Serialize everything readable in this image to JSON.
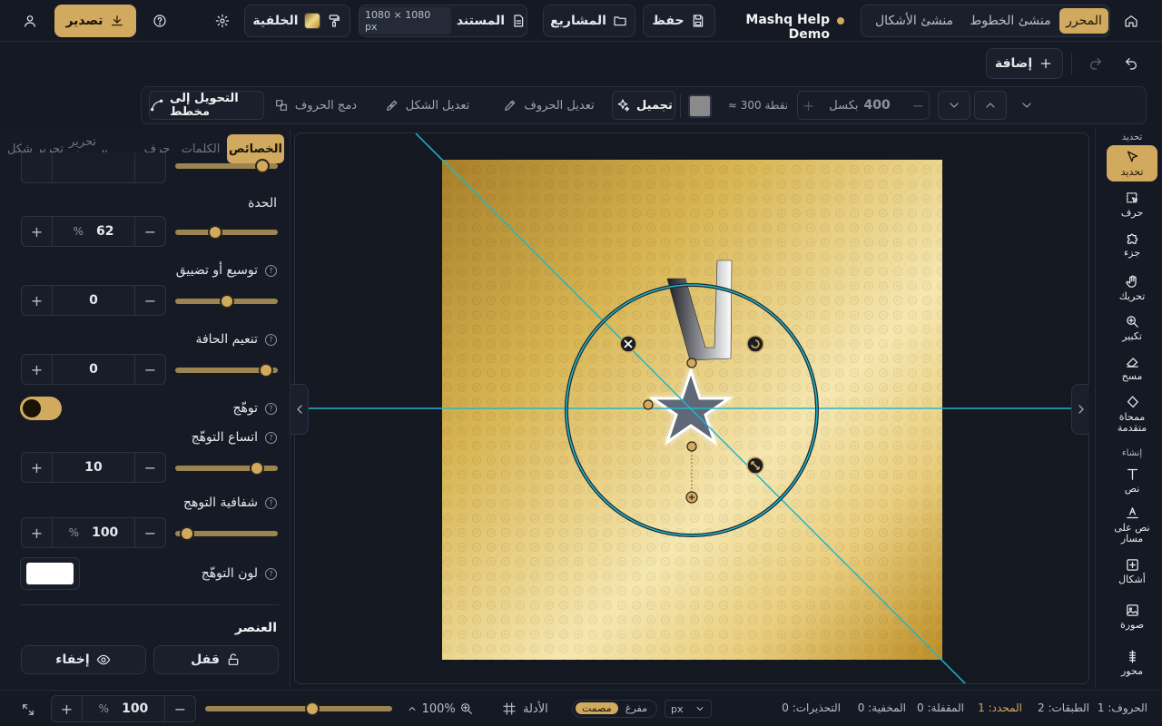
{
  "header": {
    "modes": [
      {
        "label": "المحرر",
        "active": true
      },
      {
        "label": "منشئ الخطوط",
        "active": false
      },
      {
        "label": "منشئ الأشكال",
        "active": false
      }
    ],
    "project_name": "Mashq Help Demo",
    "save_label": "حفظ",
    "projects_label": "المشاريع",
    "document_label": "المستند",
    "document_size": "1080 × 1080 px",
    "background_label": "الخلفية",
    "export_label": "تصدير"
  },
  "subheader": {
    "add_label": "إضافة"
  },
  "toolbar": {
    "width_value": "400",
    "width_unit": "بكسل",
    "points_label": "≈ 300 نقطة",
    "beautify_label": "تجميل",
    "edit_letters_label": "تعديل الحروف",
    "edit_shape_label": "تعديل الشكل",
    "merge_letters_label": "دمج الحروف",
    "convert_to_outline_label": "التحويل إلى مخطط",
    "color_swatch": "#8a8a8a"
  },
  "left_panel": {
    "tabs": [
      {
        "label": "الخصائص",
        "active": true
      },
      {
        "label": "الكلمات",
        "active": false
      },
      {
        "label": "حرف",
        "active": false
      },
      {
        "label": "تحرير الحروف",
        "active": false
      },
      {
        "label": "تحرير شكل",
        "active": false
      }
    ],
    "sharpness": {
      "label": "الحدة",
      "value": "62",
      "unit": "%",
      "slider": 0.37
    },
    "expand": {
      "label": "توسيع أو تضييق",
      "value": "0",
      "slider": 0.5
    },
    "smooth_edge": {
      "label": "تنعيم الحافة",
      "value": "0",
      "slider": 0.95
    },
    "glow": {
      "label": "توهّج",
      "enabled": true
    },
    "glow_spread": {
      "label": "اتساع التوهّج",
      "value": "10",
      "slider": 0.85
    },
    "glow_opacity": {
      "label": "شفافية التوهج",
      "value": "100",
      "unit": "%",
      "slider": 0.05
    },
    "glow_color": {
      "label": "لون التوهّج",
      "color": "#ffffff"
    },
    "element_section": "العنصر",
    "lock_label": "قفل",
    "hide_label": "إخفاء"
  },
  "right_toolbar": {
    "select_section": "تحديد",
    "tools": [
      {
        "label": "تحديد",
        "icon": "cursor-icon",
        "active": true
      },
      {
        "label": "حرف",
        "icon": "letter-select-icon"
      },
      {
        "label": "جزء",
        "icon": "part-icon"
      },
      {
        "label": "تحريك",
        "icon": "hand-icon"
      },
      {
        "label": "تكبير",
        "icon": "zoom-icon"
      },
      {
        "label": "مسح",
        "icon": "eraser-icon"
      },
      {
        "label": "ممحاة متقدمة",
        "icon": "advanced-eraser-icon"
      }
    ],
    "create_section": "إنشاء",
    "create_tools": [
      {
        "label": "نص",
        "icon": "text-icon"
      },
      {
        "label": "نص على مسار",
        "icon": "text-path-icon"
      },
      {
        "label": "أشكال",
        "icon": "shapes-icon"
      },
      {
        "label": "صورة",
        "icon": "image-icon"
      },
      {
        "label": "محور",
        "icon": "axis-icon"
      }
    ]
  },
  "status_bar": {
    "letters": "الحروف: 1",
    "layers": "الطبقات: 2",
    "selected": "المحدد: 1",
    "locked": "المقفلة: 0",
    "hidden": "المخفية: 0",
    "warnings": "التحذيرات: 0",
    "unit": "px",
    "mode_hollow": "مفرغ",
    "mode_solid": "مصمت",
    "guides_label": "الأدلة",
    "zoom_display": "100%",
    "zoom_value": "100",
    "zoom_unit": "%",
    "zoom_slider": 0.58
  },
  "canvas": {
    "glyph": "لـ",
    "gradient": [
      "#b3872a",
      "#e8cf7a",
      "#f7e9b3",
      "#d9b24c",
      "#c0922e"
    ]
  }
}
